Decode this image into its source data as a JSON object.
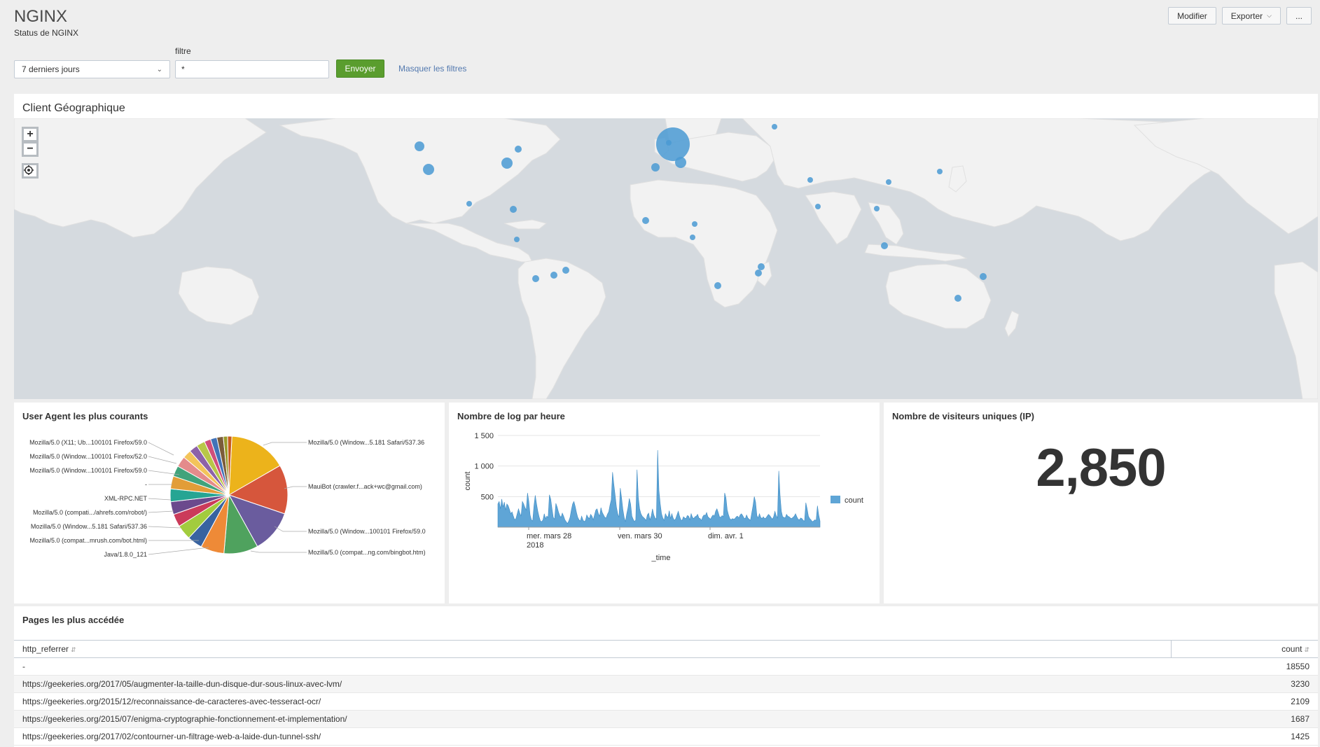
{
  "header": {
    "title": "NGINX",
    "subtitle": "Status de NGINX",
    "actions": {
      "edit": "Modifier",
      "export": "Exporter",
      "more": "..."
    }
  },
  "filters": {
    "time_label": "7 derniers jours",
    "filter_label": "filtre",
    "filter_value": "*",
    "submit": "Envoyer",
    "hide": "Masquer les filtres"
  },
  "map": {
    "title": "Client Géographique",
    "controls": {
      "zoom_in": "+",
      "zoom_out": "−"
    },
    "marker_color": "#4a9ad4"
  },
  "pie": {
    "title": "User Agent les plus courants"
  },
  "line": {
    "title": "Nombre de log par heure"
  },
  "single": {
    "title": "Nombre de visiteurs uniques (IP)",
    "value": "2,850"
  },
  "table": {
    "title": "Pages les plus accédée",
    "col_referrer": "http_referrer",
    "col_count": "count",
    "rows": [
      {
        "referrer": "-",
        "count": "18550"
      },
      {
        "referrer": "https://geekeries.org/2017/05/augmenter-la-taille-dun-disque-dur-sous-linux-avec-lvm/",
        "count": "3230"
      },
      {
        "referrer": "https://geekeries.org/2015/12/reconnaissance-de-caracteres-avec-tesseract-ocr/",
        "count": "2109"
      },
      {
        "referrer": "https://geekeries.org/2015/07/enigma-cryptographie-fonctionnement-et-implementation/",
        "count": "1687"
      },
      {
        "referrer": "https://geekeries.org/2017/02/contourner-un-filtrage-web-a-laide-dun-tunnel-ssh/",
        "count": "1425"
      }
    ]
  },
  "chart_data": [
    {
      "type": "pie",
      "title": "User Agent les plus courants",
      "categories": [
        "Mozilla/5.0 (Window...5.181 Safari/537.36",
        "MauiBot (crawler.f...ack+wc@gmail.com)",
        "Mozilla/5.0 (Window...100101 Firefox/59.0",
        "Mozilla/5.0 (compat...ng.com/bingbot.htm)",
        "Java/1.8.0_121",
        "Mozilla/5.0 (compat...mrush.com/bot.html)",
        "Mozilla/5.0 (Window...5.181 Safari/537.36",
        "Mozilla/5.0 (compati.../ahrefs.com/robot/)",
        "XML-RPC.NET",
        "-",
        "Mozilla/5.0 (Window...100101 Firefox/59.0",
        "Mozilla/5.0 (Window...100101 Firefox/52.0",
        "Mozilla/5.0 (X11; Ub...100101 Firefox/59.0"
      ],
      "values": [
        13.5,
        11.5,
        10,
        8,
        5.5,
        3.5,
        3.5,
        3,
        3,
        3,
        3,
        2.5,
        2.5,
        2,
        2,
        2,
        1.5,
        1.5,
        1.5,
        1,
        1
      ],
      "colors": [
        "#ecb31b",
        "#d6563c",
        "#6a5c9e",
        "#4fa25e",
        "#ee8a37",
        "#3863a0",
        "#a2cc3e",
        "#cb3b5a",
        "#6b4a8d",
        "#26a593",
        "#e29d38",
        "#41a37b",
        "#e48b8b",
        "#f3c45a",
        "#8d62a8",
        "#b8c748",
        "#d04f7a",
        "#4273b8",
        "#7b5c3a",
        "#9a9a2a",
        "#c85a1e"
      ]
    },
    {
      "type": "area",
      "title": "Nombre de log par heure",
      "xlabel": "_time",
      "ylabel": "count",
      "ylim": [
        0,
        1500
      ],
      "y_ticks": [
        "500",
        "1 000",
        "1 500"
      ],
      "x_ticks": [
        "mer. mars 28\n2018",
        "ven. mars 30",
        "dim. avr. 1"
      ],
      "series": [
        {
          "name": "count",
          "color": "#5fa5d6",
          "values": [
            380,
            420,
            300,
            460,
            330,
            410,
            280,
            380,
            350,
            290,
            220,
            250,
            180,
            120,
            140,
            220,
            300,
            230,
            180,
            420,
            380,
            320,
            280,
            560,
            420,
            200,
            120,
            100,
            350,
            520,
            380,
            260,
            170,
            100,
            90,
            120,
            220,
            140,
            180,
            160,
            530,
            460,
            300,
            160,
            130,
            390,
            330,
            250,
            190,
            160,
            230,
            180,
            120,
            90,
            60,
            100,
            160,
            280,
            380,
            420,
            340,
            240,
            160,
            120,
            100,
            180,
            120,
            90,
            110,
            200,
            160,
            140,
            210,
            180,
            120,
            200,
            280,
            300,
            220,
            180,
            320,
            240,
            200,
            160,
            150,
            210,
            250,
            360,
            450,
            900,
            700,
            520,
            330,
            220,
            160,
            640,
            480,
            290,
            160,
            90,
            220,
            320,
            470,
            380,
            180,
            130,
            90,
            120,
            940,
            480,
            300,
            220,
            180,
            160,
            140,
            110,
            200,
            230,
            120,
            180,
            300,
            200,
            150,
            130,
            1260,
            600,
            380,
            220,
            150,
            110,
            220,
            180,
            160,
            270,
            140,
            220,
            150,
            110,
            140,
            200,
            260,
            180,
            120,
            110,
            170,
            150,
            140,
            190,
            180,
            120,
            220,
            160,
            140,
            170,
            180,
            210,
            150,
            140,
            110,
            170,
            200,
            190,
            240,
            170,
            150,
            130,
            170,
            200,
            180,
            260,
            300,
            240,
            170,
            160,
            190,
            170,
            560,
            480,
            280,
            200,
            140,
            120,
            140,
            130,
            140,
            170,
            180,
            150,
            200,
            220,
            190,
            150,
            140,
            200,
            150,
            130,
            110,
            230,
            350,
            500,
            410,
            190,
            150,
            220,
            160,
            140,
            170,
            140,
            150,
            180,
            210,
            190,
            160,
            130,
            170,
            260,
            190,
            150,
            920,
            520,
            260,
            170,
            160,
            150,
            210,
            180,
            170,
            150,
            140,
            160,
            180,
            220,
            170,
            130,
            120,
            150,
            140,
            110,
            100,
            400,
            300,
            180,
            140,
            120,
            90,
            100,
            120,
            110,
            350,
            200,
            100
          ]
        }
      ]
    }
  ]
}
